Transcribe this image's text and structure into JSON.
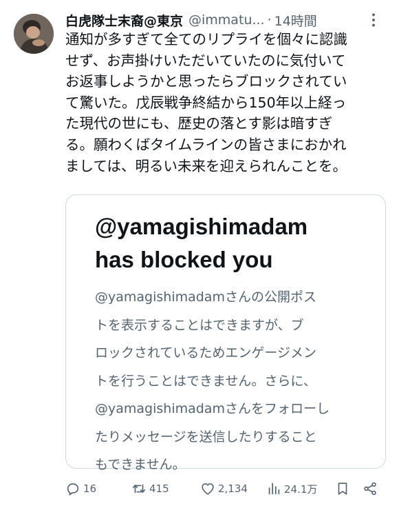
{
  "author": {
    "display_name": "白虎隊士末裔@東京",
    "handle": "@immatu...",
    "separator": "·",
    "time": "14時間"
  },
  "tweet": {
    "text": "通知が多すぎて全てのリプライを個々に認識\nせず、お声掛けいただいていたのに気付いて\nお返事しようかと思ったらブロックされてい\nて驚いた。戊辰戦争終結から150年以上経っ\nた現代の世にも、歴史の落とす影は暗すぎ\nる。願わくばタイムラインの皆さまにおかれ\nましては、明るい未来を迎えられんことを。"
  },
  "card": {
    "title": "@yamagishimadam\nhas blocked you",
    "body": "@yamagishimadamさんの公開ポス\nトを表示することはできますが、ブ\nロックされているためエンゲージメン\nトを行うことはできません。さらに、\n@yamagishimadamさんをフォローし\nたりメッセージを送信したりすること\nもできません。"
  },
  "actions": {
    "replies": "16",
    "reposts": "415",
    "likes": "2,134",
    "views": "24.1万"
  },
  "icons": [
    "more-icon",
    "reply-icon",
    "repost-icon",
    "like-icon",
    "views-icon",
    "bookmark-icon",
    "share-icon"
  ],
  "colors": {
    "text": "#0f1419",
    "secondary": "#536471",
    "border": "#cfd9de"
  }
}
